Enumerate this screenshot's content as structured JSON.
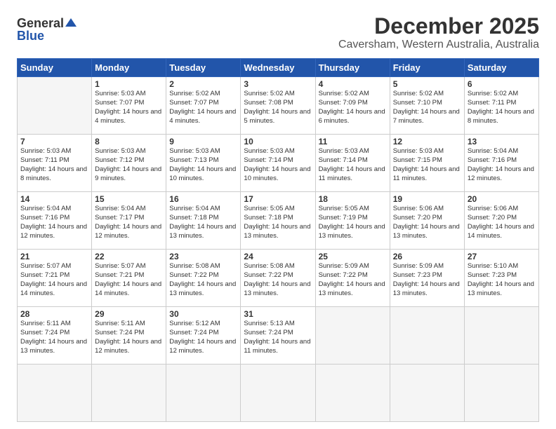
{
  "logo": {
    "general": "General",
    "blue": "Blue"
  },
  "title": "December 2025",
  "subtitle": "Caversham, Western Australia, Australia",
  "headers": [
    "Sunday",
    "Monday",
    "Tuesday",
    "Wednesday",
    "Thursday",
    "Friday",
    "Saturday"
  ],
  "days": [
    {
      "num": "",
      "sunrise": "",
      "sunset": "",
      "daylight": ""
    },
    {
      "num": "1",
      "sunrise": "5:03 AM",
      "sunset": "7:07 PM",
      "daylight": "14 hours and 4 minutes."
    },
    {
      "num": "2",
      "sunrise": "5:02 AM",
      "sunset": "7:07 PM",
      "daylight": "14 hours and 4 minutes."
    },
    {
      "num": "3",
      "sunrise": "5:02 AM",
      "sunset": "7:08 PM",
      "daylight": "14 hours and 5 minutes."
    },
    {
      "num": "4",
      "sunrise": "5:02 AM",
      "sunset": "7:09 PM",
      "daylight": "14 hours and 6 minutes."
    },
    {
      "num": "5",
      "sunrise": "5:02 AM",
      "sunset": "7:10 PM",
      "daylight": "14 hours and 7 minutes."
    },
    {
      "num": "6",
      "sunrise": "5:02 AM",
      "sunset": "7:11 PM",
      "daylight": "14 hours and 8 minutes."
    },
    {
      "num": "7",
      "sunrise": "5:03 AM",
      "sunset": "7:11 PM",
      "daylight": "14 hours and 8 minutes."
    },
    {
      "num": "8",
      "sunrise": "5:03 AM",
      "sunset": "7:12 PM",
      "daylight": "14 hours and 9 minutes."
    },
    {
      "num": "9",
      "sunrise": "5:03 AM",
      "sunset": "7:13 PM",
      "daylight": "14 hours and 10 minutes."
    },
    {
      "num": "10",
      "sunrise": "5:03 AM",
      "sunset": "7:14 PM",
      "daylight": "14 hours and 10 minutes."
    },
    {
      "num": "11",
      "sunrise": "5:03 AM",
      "sunset": "7:14 PM",
      "daylight": "14 hours and 11 minutes."
    },
    {
      "num": "12",
      "sunrise": "5:03 AM",
      "sunset": "7:15 PM",
      "daylight": "14 hours and 11 minutes."
    },
    {
      "num": "13",
      "sunrise": "5:04 AM",
      "sunset": "7:16 PM",
      "daylight": "14 hours and 12 minutes."
    },
    {
      "num": "14",
      "sunrise": "5:04 AM",
      "sunset": "7:16 PM",
      "daylight": "14 hours and 12 minutes."
    },
    {
      "num": "15",
      "sunrise": "5:04 AM",
      "sunset": "7:17 PM",
      "daylight": "14 hours and 12 minutes."
    },
    {
      "num": "16",
      "sunrise": "5:04 AM",
      "sunset": "7:18 PM",
      "daylight": "14 hours and 13 minutes."
    },
    {
      "num": "17",
      "sunrise": "5:05 AM",
      "sunset": "7:18 PM",
      "daylight": "14 hours and 13 minutes."
    },
    {
      "num": "18",
      "sunrise": "5:05 AM",
      "sunset": "7:19 PM",
      "daylight": "14 hours and 13 minutes."
    },
    {
      "num": "19",
      "sunrise": "5:06 AM",
      "sunset": "7:20 PM",
      "daylight": "14 hours and 13 minutes."
    },
    {
      "num": "20",
      "sunrise": "5:06 AM",
      "sunset": "7:20 PM",
      "daylight": "14 hours and 14 minutes."
    },
    {
      "num": "21",
      "sunrise": "5:07 AM",
      "sunset": "7:21 PM",
      "daylight": "14 hours and 14 minutes."
    },
    {
      "num": "22",
      "sunrise": "5:07 AM",
      "sunset": "7:21 PM",
      "daylight": "14 hours and 14 minutes."
    },
    {
      "num": "23",
      "sunrise": "5:08 AM",
      "sunset": "7:22 PM",
      "daylight": "14 hours and 13 minutes."
    },
    {
      "num": "24",
      "sunrise": "5:08 AM",
      "sunset": "7:22 PM",
      "daylight": "14 hours and 13 minutes."
    },
    {
      "num": "25",
      "sunrise": "5:09 AM",
      "sunset": "7:22 PM",
      "daylight": "14 hours and 13 minutes."
    },
    {
      "num": "26",
      "sunrise": "5:09 AM",
      "sunset": "7:23 PM",
      "daylight": "14 hours and 13 minutes."
    },
    {
      "num": "27",
      "sunrise": "5:10 AM",
      "sunset": "7:23 PM",
      "daylight": "14 hours and 13 minutes."
    },
    {
      "num": "28",
      "sunrise": "5:11 AM",
      "sunset": "7:24 PM",
      "daylight": "14 hours and 13 minutes."
    },
    {
      "num": "29",
      "sunrise": "5:11 AM",
      "sunset": "7:24 PM",
      "daylight": "14 hours and 12 minutes."
    },
    {
      "num": "30",
      "sunrise": "5:12 AM",
      "sunset": "7:24 PM",
      "daylight": "14 hours and 12 minutes."
    },
    {
      "num": "31",
      "sunrise": "5:13 AM",
      "sunset": "7:24 PM",
      "daylight": "14 hours and 11 minutes."
    },
    {
      "num": "",
      "sunrise": "",
      "sunset": "",
      "daylight": ""
    },
    {
      "num": "",
      "sunrise": "",
      "sunset": "",
      "daylight": ""
    },
    {
      "num": "",
      "sunrise": "",
      "sunset": "",
      "daylight": ""
    },
    {
      "num": "",
      "sunrise": "",
      "sunset": "",
      "daylight": ""
    }
  ],
  "labels": {
    "sunrise": "Sunrise:",
    "sunset": "Sunset:",
    "daylight": "Daylight:"
  }
}
